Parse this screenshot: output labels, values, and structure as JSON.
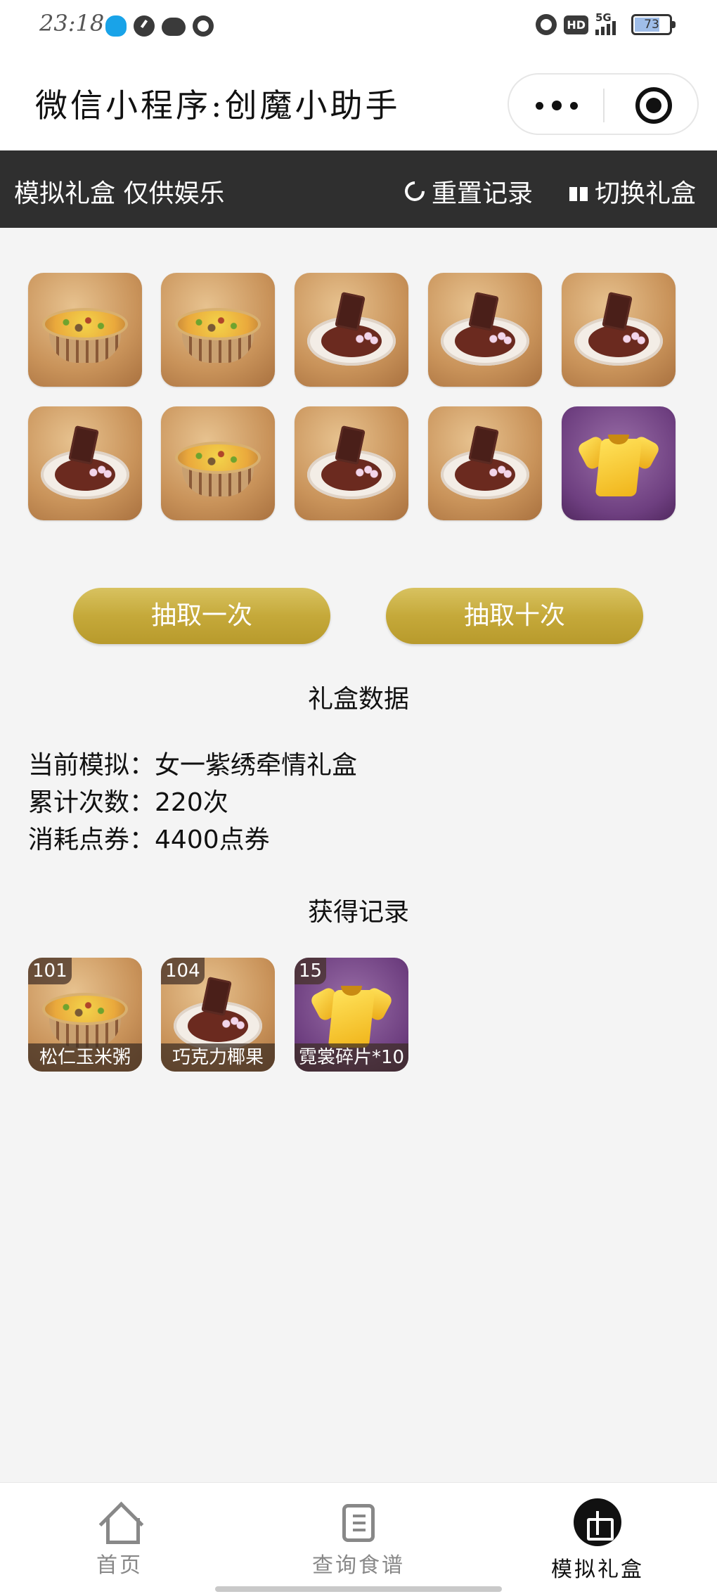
{
  "status_bar": {
    "time": "23:18",
    "battery": "73",
    "network": "5G",
    "hd": "HD"
  },
  "mini_program": {
    "title": "微信小程序:创魔小助手"
  },
  "header": {
    "title": "模拟礼盒 仅供娱乐",
    "reset_label": "重置记录",
    "switch_label": "切换礼盒"
  },
  "draw_results": [
    {
      "item": "松仁玉米粥"
    },
    {
      "item": "松仁玉米粥"
    },
    {
      "item": "巧克力椰果"
    },
    {
      "item": "巧克力椰果"
    },
    {
      "item": "巧克力椰果"
    },
    {
      "item": "巧克力椰果"
    },
    {
      "item": "松仁玉米粥"
    },
    {
      "item": "巧克力椰果"
    },
    {
      "item": "巧克力椰果"
    },
    {
      "item": "霓裳碎片*10"
    }
  ],
  "buttons": {
    "draw_once": "抽取一次",
    "draw_ten": "抽取十次"
  },
  "box_data": {
    "title": "礼盒数据",
    "current_label": "当前模拟：",
    "current_value": "女一紫绣牵情礼盒",
    "count_label": "累计次数：",
    "count_value": "220次",
    "cost_label": "消耗点券：",
    "cost_value": "4400点券"
  },
  "records": {
    "title": "获得记录",
    "items": [
      {
        "count": "101",
        "name": "松仁玉米粥"
      },
      {
        "count": "104",
        "name": "巧克力椰果"
      },
      {
        "count": "15",
        "name": "霓裳碎片*10"
      }
    ]
  },
  "tabbar": {
    "home": "首页",
    "recipes": "查询食谱",
    "gift": "模拟礼盒"
  },
  "colors": {
    "header_bg": "#2f2f2f",
    "button_gold": "#c5a93a",
    "page_bg": "#f4f4f4"
  }
}
